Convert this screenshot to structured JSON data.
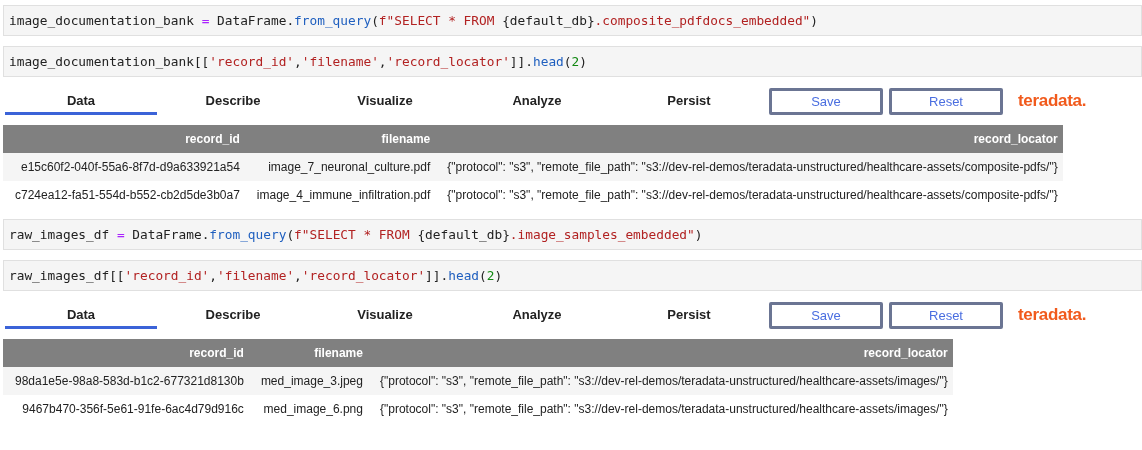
{
  "cells": [
    {
      "kind": "code",
      "tokens": [
        {
          "text": "image_documentation_bank ",
          "kind": "plain"
        },
        {
          "text": "=",
          "kind": "op"
        },
        {
          "text": " DataFrame.",
          "kind": "plain"
        },
        {
          "text": "from_query",
          "kind": "func"
        },
        {
          "text": "(",
          "kind": "plain"
        },
        {
          "text": "f\"SELECT * FROM ",
          "kind": "str"
        },
        {
          "text": "{default_db}",
          "kind": "plain"
        },
        {
          "text": ".composite_pdfdocs_embedded\"",
          "kind": "str"
        },
        {
          "text": ")",
          "kind": "plain"
        }
      ]
    },
    {
      "kind": "code",
      "tokens": [
        {
          "text": "image_documentation_bank[[",
          "kind": "plain"
        },
        {
          "text": "'record_id'",
          "kind": "str"
        },
        {
          "text": ",",
          "kind": "plain"
        },
        {
          "text": "'filename'",
          "kind": "str"
        },
        {
          "text": ",",
          "kind": "plain"
        },
        {
          "text": "'record_locator'",
          "kind": "str"
        },
        {
          "text": "]].",
          "kind": "plain"
        },
        {
          "text": "head",
          "kind": "func"
        },
        {
          "text": "(",
          "kind": "plain"
        },
        {
          "text": "2",
          "kind": "num"
        },
        {
          "text": ")",
          "kind": "plain"
        }
      ]
    },
    {
      "kind": "output",
      "tabs": [
        {
          "label": "Data",
          "selected": true
        },
        {
          "label": "Describe",
          "selected": false
        },
        {
          "label": "Visualize",
          "selected": false
        },
        {
          "label": "Analyze",
          "selected": false
        },
        {
          "label": "Persist",
          "selected": false
        }
      ],
      "buttons": [
        "Save",
        "Reset"
      ],
      "logo": "teradata.",
      "table": {
        "columns": [
          "record_id",
          "filename",
          "record_locator"
        ],
        "rows": [
          [
            "e15c60f2-040f-55a6-8f7d-d9a633921a54",
            "image_7_neuronal_culture.pdf",
            "{\"protocol\": \"s3\", \"remote_file_path\": \"s3://dev-rel-demos/teradata-unstructured/healthcare-assets/composite-pdfs/\"}"
          ],
          [
            "c724ea12-fa51-554d-b552-cb2d5de3b0a7",
            "image_4_immune_infiltration.pdf",
            "{\"protocol\": \"s3\", \"remote_file_path\": \"s3://dev-rel-demos/teradata-unstructured/healthcare-assets/composite-pdfs/\"}"
          ]
        ]
      }
    },
    {
      "kind": "code",
      "tokens": [
        {
          "text": "raw_images_df ",
          "kind": "plain"
        },
        {
          "text": "=",
          "kind": "op"
        },
        {
          "text": " DataFrame.",
          "kind": "plain"
        },
        {
          "text": "from_query",
          "kind": "func"
        },
        {
          "text": "(",
          "kind": "plain"
        },
        {
          "text": "f\"SELECT * FROM ",
          "kind": "str"
        },
        {
          "text": "{default_db}",
          "kind": "plain"
        },
        {
          "text": ".image_samples_embedded\"",
          "kind": "str"
        },
        {
          "text": ")",
          "kind": "plain"
        }
      ]
    },
    {
      "kind": "code",
      "tokens": [
        {
          "text": "raw_images_df[[",
          "kind": "plain"
        },
        {
          "text": "'record_id'",
          "kind": "str"
        },
        {
          "text": ",",
          "kind": "plain"
        },
        {
          "text": "'filename'",
          "kind": "str"
        },
        {
          "text": ",",
          "kind": "plain"
        },
        {
          "text": "'record_locator'",
          "kind": "str"
        },
        {
          "text": "]].",
          "kind": "plain"
        },
        {
          "text": "head",
          "kind": "func"
        },
        {
          "text": "(",
          "kind": "plain"
        },
        {
          "text": "2",
          "kind": "num"
        },
        {
          "text": ")",
          "kind": "plain"
        }
      ]
    },
    {
      "kind": "output",
      "tabs": [
        {
          "label": "Data",
          "selected": true
        },
        {
          "label": "Describe",
          "selected": false
        },
        {
          "label": "Visualize",
          "selected": false
        },
        {
          "label": "Analyze",
          "selected": false
        },
        {
          "label": "Persist",
          "selected": false
        }
      ],
      "buttons": [
        "Save",
        "Reset"
      ],
      "logo": "teradata.",
      "table": {
        "columns": [
          "record_id",
          "filename",
          "record_locator"
        ],
        "rows": [
          [
            "98da1e5e-98a8-583d-b1c2-677321d8130b",
            "med_image_3.jpeg",
            "{\"protocol\": \"s3\", \"remote_file_path\": \"s3://dev-rel-demos/teradata-unstructured/healthcare-assets/images/\"}"
          ],
          [
            "9467b470-356f-5e61-91fe-6ac4d79d916c",
            "med_image_6.png",
            "{\"protocol\": \"s3\", \"remote_file_path\": \"s3://dev-rel-demos/teradata-unstructured/healthcare-assets/images/\"}"
          ]
        ]
      }
    }
  ]
}
